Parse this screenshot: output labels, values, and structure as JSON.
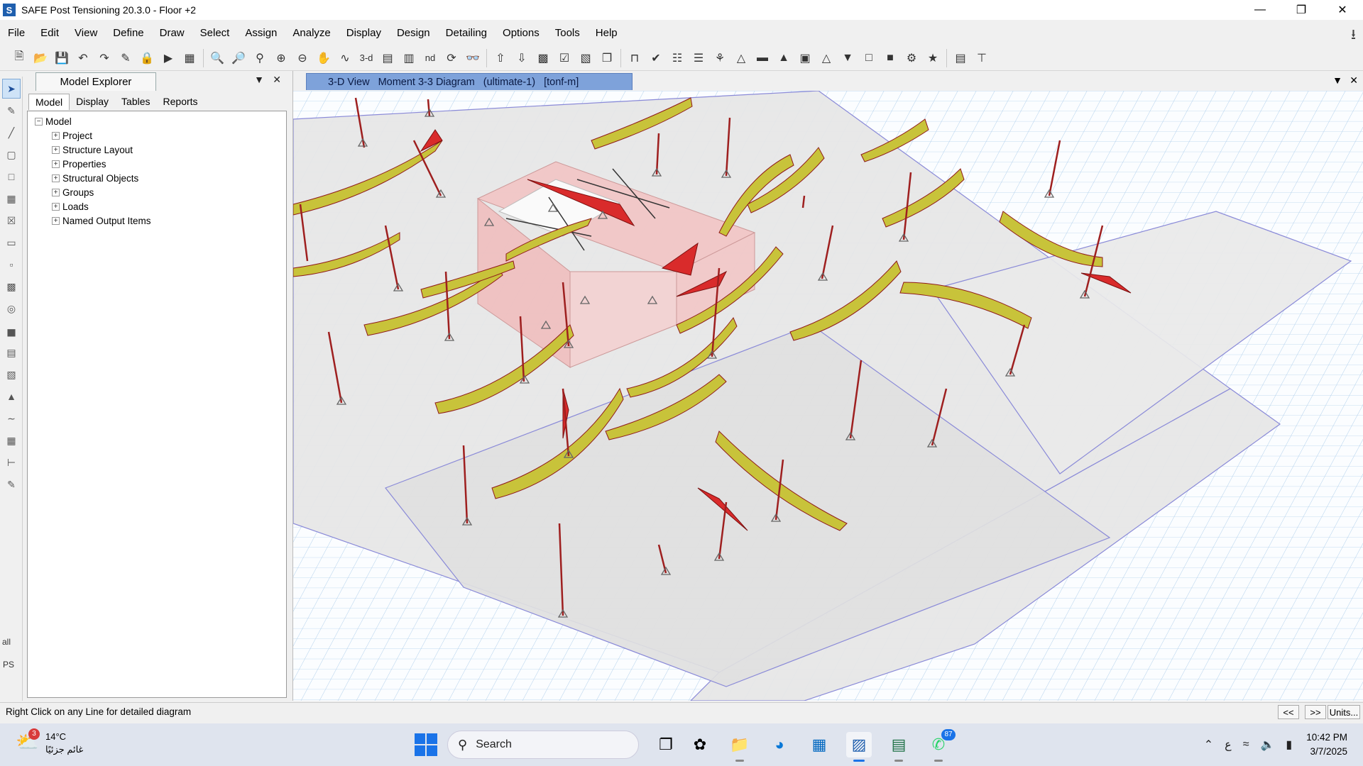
{
  "window": {
    "title": "SAFE Post Tensioning 20.3.0 - Floor +2",
    "app_icon_letter": "S"
  },
  "menu": [
    "File",
    "Edit",
    "View",
    "Define",
    "Draw",
    "Select",
    "Assign",
    "Analyze",
    "Display",
    "Design",
    "Detailing",
    "Options",
    "Tools",
    "Help"
  ],
  "toolbar": {
    "view_3d_label": "3-d",
    "nd_label": "nd"
  },
  "explorer": {
    "title": "Model Explorer",
    "tabs": [
      "Model",
      "Display",
      "Tables",
      "Reports"
    ],
    "root": "Model",
    "items": [
      "Project",
      "Structure Layout",
      "Properties",
      "Structural Objects",
      "Groups",
      "Loads",
      "Named Output Items"
    ]
  },
  "viewport": {
    "tab_parts": [
      "3-D View",
      "Moment 3-3 Diagram",
      "(ultimate-1)",
      "[tonf-m]"
    ]
  },
  "left_tools": {
    "all_label": "all",
    "ps_label": "PS"
  },
  "status": {
    "message": "Right Click on any Line for detailed diagram",
    "prev_label": "<<",
    "next_label": ">>",
    "units_label": "Units..."
  },
  "taskbar": {
    "weather_temp": "14°C",
    "weather_desc": "غائم جزئيًا",
    "weather_badge": "3",
    "search_label": "Search",
    "whatsapp_badge": "87",
    "lang": "ع",
    "time": "10:42 PM",
    "date": "3/7/2025"
  },
  "colors": {
    "accent_tab": "#7ea2da",
    "moment_positive": "#c7c23a",
    "moment_negative": "#d92b2b",
    "grid": "#9fc3e6"
  }
}
